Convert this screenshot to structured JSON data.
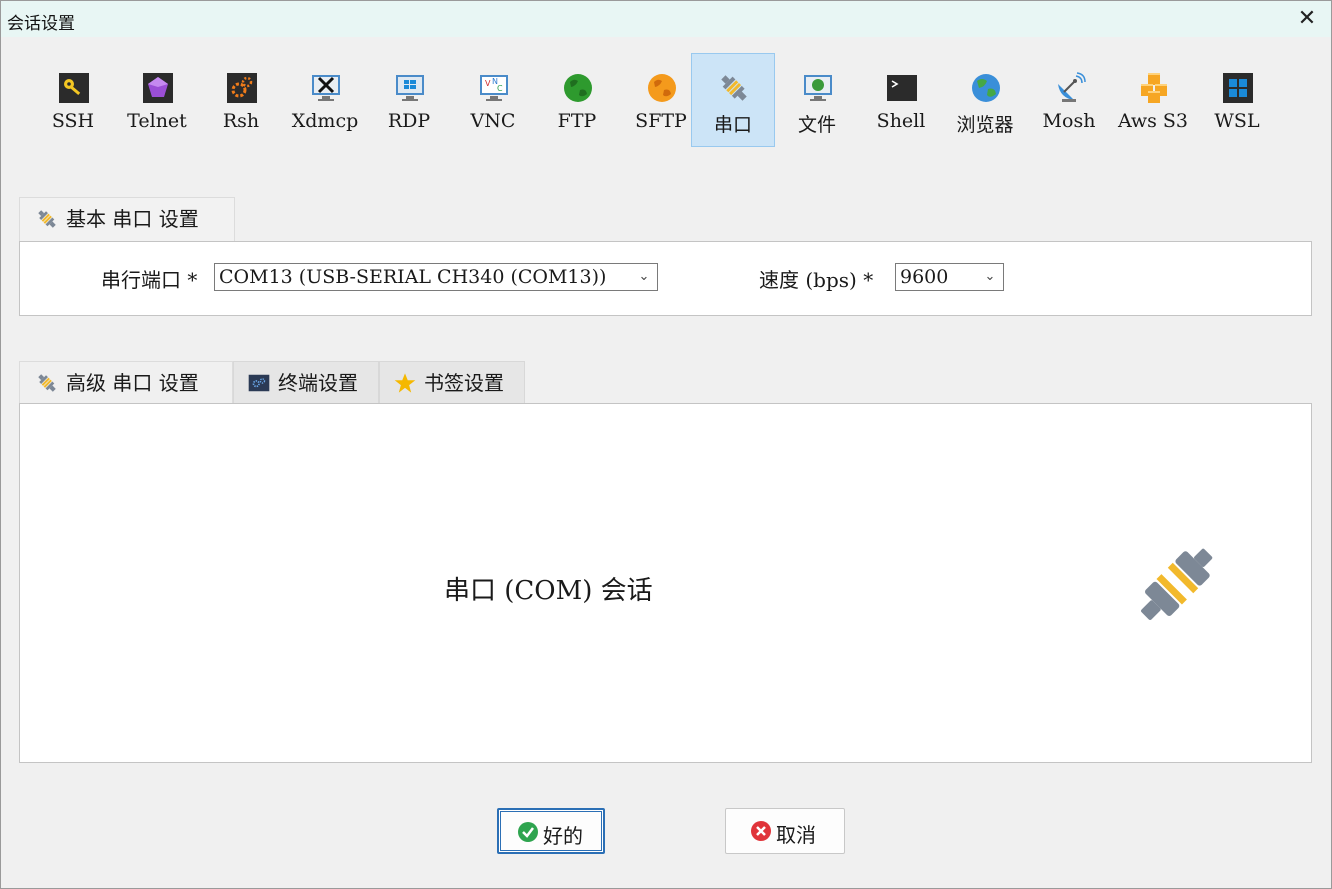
{
  "window": {
    "title": "会话设置",
    "close_glyph": "✕"
  },
  "session_types": [
    {
      "label": "SSH",
      "icon": "key-icon"
    },
    {
      "label": "Telnet",
      "icon": "telnet-gem-icon"
    },
    {
      "label": "Rsh",
      "icon": "rsh-gears-icon"
    },
    {
      "label": "Xdmcp",
      "icon": "x-monitor-icon"
    },
    {
      "label": "RDP",
      "icon": "windows-monitor-icon"
    },
    {
      "label": "VNC",
      "icon": "vnc-monitor-icon"
    },
    {
      "label": "FTP",
      "icon": "green-globe-icon"
    },
    {
      "label": "SFTP",
      "icon": "orange-globe-icon"
    },
    {
      "label": "串口",
      "icon": "plug-icon",
      "active": true
    },
    {
      "label": "文件",
      "icon": "globe-monitor-icon"
    },
    {
      "label": "Shell",
      "icon": "terminal-icon"
    },
    {
      "label": "浏览器",
      "icon": "earth-icon"
    },
    {
      "label": "Mosh",
      "icon": "satellite-dish-icon"
    },
    {
      "label": "Aws S3",
      "icon": "aws-cubes-icon"
    },
    {
      "label": "WSL",
      "icon": "windows-logo-icon"
    }
  ],
  "basic": {
    "tab_label": "基本 串口 设置",
    "port_label": "串行端口 *",
    "port_value": "COM13  (USB-SERIAL CH340 (COM13))",
    "speed_label": "速度 (bps) *",
    "speed_value": "9600"
  },
  "advanced_tabs": [
    {
      "label": "高级 串口 设置",
      "icon": "plug-icon"
    },
    {
      "label": "终端设置",
      "icon": "terminal-gear-icon"
    },
    {
      "label": "书签设置",
      "icon": "star-icon"
    }
  ],
  "advanced_panel": {
    "session_text": "串口 (COM) 会话"
  },
  "buttons": {
    "ok_label": "好的",
    "cancel_label": "取消"
  },
  "colors": {
    "active_tool_bg": "#cce4f7",
    "active_tool_border": "#99c9ef",
    "titlebar_bg": "#e8f6f4",
    "ok_icon": "#2ea44f",
    "cancel_icon": "#e0343a",
    "star": "#f5b800",
    "plug_body": "#7d8896",
    "plug_band": "#f2b92c"
  }
}
